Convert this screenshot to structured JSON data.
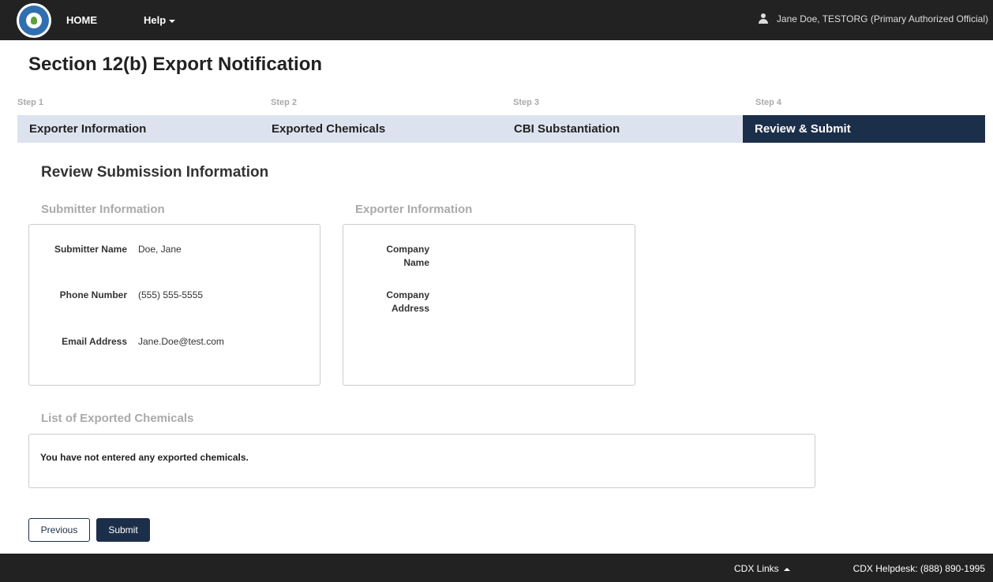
{
  "nav": {
    "home": "HOME",
    "help": "Help",
    "user": "Jane Doe, TESTORG (Primary Authorized Official)"
  },
  "page": {
    "title": "Section 12(b) Export Notification"
  },
  "steps": [
    {
      "step": "Step 1",
      "label": "Exporter Information"
    },
    {
      "step": "Step 2",
      "label": "Exported Chemicals"
    },
    {
      "step": "Step 3",
      "label": "CBI Substantiation"
    },
    {
      "step": "Step 4",
      "label": "Review & Submit"
    }
  ],
  "review": {
    "title": "Review Submission Information",
    "submitter": {
      "heading": "Submitter Information",
      "name_label": "Submitter Name",
      "name_value": "Doe, Jane",
      "phone_label": "Phone Number",
      "phone_value": "(555) 555-5555",
      "email_label": "Email Address",
      "email_value": "Jane.Doe@test.com"
    },
    "exporter": {
      "heading": "Exporter Information",
      "company_name_label": "Company Name",
      "company_address_label": "Company Address"
    },
    "chemicals": {
      "heading": "List of Exported Chemicals",
      "empty_message": "You have not entered any exported chemicals."
    }
  },
  "buttons": {
    "previous": "Previous",
    "submit": "Submit"
  },
  "footer": {
    "links": "CDX Links",
    "helpdesk": "CDX Helpdesk: (888) 890-1995"
  },
  "colors": {
    "navbar": "#222222",
    "active_step": "#1c2f4a",
    "step_bg": "#dde3ee",
    "subhead": "#aaaaaa"
  }
}
